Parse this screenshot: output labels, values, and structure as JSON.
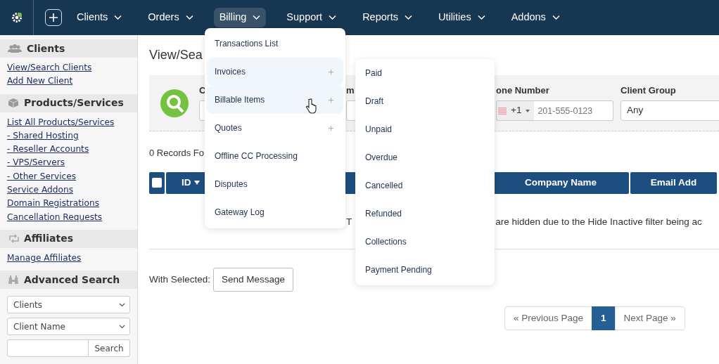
{
  "navbar": {
    "items": [
      {
        "label": "Clients",
        "selected": false
      },
      {
        "label": "Orders",
        "selected": false
      },
      {
        "label": "Billing",
        "selected": true
      },
      {
        "label": "Support",
        "selected": false
      },
      {
        "label": "Reports",
        "selected": false
      },
      {
        "label": "Utilities",
        "selected": false
      },
      {
        "label": "Addons",
        "selected": false
      }
    ]
  },
  "sidebar": {
    "sections": [
      {
        "title": "Clients",
        "links": [
          "View/Search Clients",
          "Add New Client"
        ]
      },
      {
        "title": "Products/Services",
        "links": [
          "List All Products/Services",
          "- Shared Hosting",
          "- Reseller Accounts",
          "- VPS/Servers",
          "- Other Services",
          "Service Addons",
          "Domain Registrations",
          "Cancellation Requests"
        ]
      },
      {
        "title": "Affiliates",
        "links": [
          "Manage Affiliates"
        ]
      },
      {
        "title": "Advanced Search"
      }
    ],
    "advanced_search": {
      "selects": [
        "Clients",
        "Client Name"
      ],
      "button": "Search"
    }
  },
  "main": {
    "title": "View/Sea",
    "search_panel": {
      "fields": [
        {
          "kind": "text",
          "label": "C"
        },
        {
          "kind": "text",
          "label": "m"
        },
        {
          "kind": "phone",
          "label": "one Number",
          "dial_code": "+1",
          "placeholder": "201-555-0123"
        },
        {
          "kind": "select",
          "label": "Client Group",
          "value": "Any"
        }
      ]
    },
    "records": "0 Records Fo",
    "table": {
      "select_all_checked": false,
      "columns": [
        "ID",
        "Company Name",
        "Email Add"
      ],
      "message_parts": [
        "T",
        "are hidden due to the Hide Inactive filter being ac"
      ]
    },
    "with_selected": {
      "label": "With Selected:",
      "button": "Send Message"
    },
    "pagination": [
      {
        "label": "« Previous Page",
        "selected": false
      },
      {
        "label": "1",
        "selected": true
      },
      {
        "label": "Next Page »",
        "selected": false
      }
    ]
  },
  "billing_menu": {
    "items": [
      {
        "label": "Transactions List",
        "expandable": false,
        "highlighted": false
      },
      {
        "label": "Invoices",
        "expandable": true,
        "highlighted": true
      },
      {
        "label": "Billable Items",
        "expandable": true,
        "highlighted": true
      },
      {
        "label": "Quotes",
        "expandable": true,
        "highlighted": false
      },
      {
        "label": "Offline CC Processing",
        "expandable": false,
        "highlighted": false
      },
      {
        "label": "Disputes",
        "expandable": false,
        "highlighted": false
      },
      {
        "label": "Gateway Log",
        "expandable": false,
        "highlighted": false
      }
    ]
  },
  "invoices_submenu": {
    "items": [
      "Paid",
      "Draft",
      "Unpaid",
      "Overdue",
      "Cancelled",
      "Refunded",
      "Collections",
      "Payment Pending"
    ]
  }
}
